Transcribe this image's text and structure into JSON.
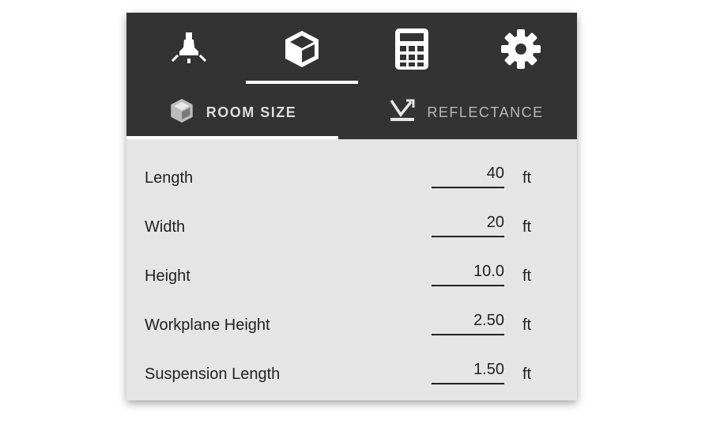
{
  "icon_tabs": [
    {
      "icon": "ceiling-lamp-icon",
      "active": false
    },
    {
      "icon": "cube-icon",
      "active": true
    },
    {
      "icon": "calculator-icon",
      "active": false
    },
    {
      "icon": "gear-icon",
      "active": false
    }
  ],
  "sub_tabs": [
    {
      "label": "ROOM SIZE",
      "icon": "cube-icon",
      "active": true
    },
    {
      "label": "REFLECTANCE",
      "icon": "reflectance-icon",
      "active": false
    }
  ],
  "fields": [
    {
      "label": "Length",
      "value": "40",
      "unit": "ft"
    },
    {
      "label": "Width",
      "value": "20",
      "unit": "ft"
    },
    {
      "label": "Height",
      "value": "10.0",
      "unit": "ft"
    },
    {
      "label": "Workplane Height",
      "value": "2.50",
      "unit": "ft"
    },
    {
      "label": "Suspension Length",
      "value": "1.50",
      "unit": "ft"
    }
  ],
  "colors": {
    "header": "#333333",
    "panel": "#e5e5e5",
    "indicator": "#ffffff"
  }
}
